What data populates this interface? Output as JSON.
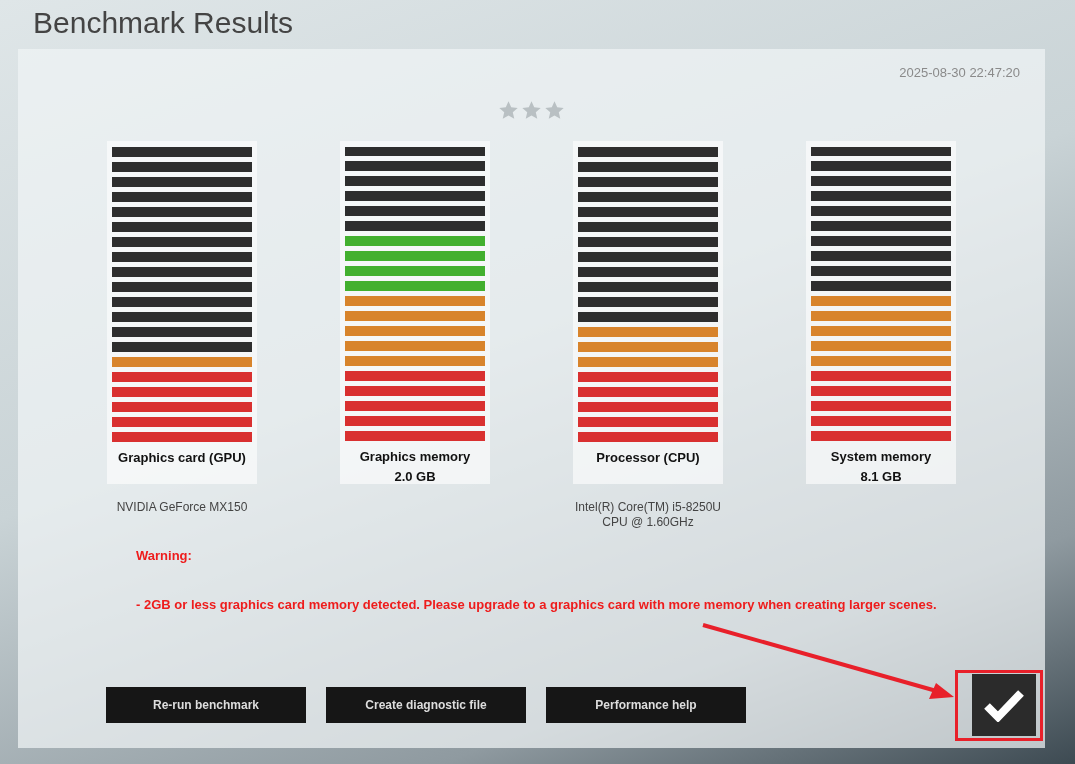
{
  "title": "Benchmark Results",
  "timestamp": "2025-08-30 22:47:20",
  "rating": {
    "stars": 0
  },
  "components": [
    {
      "label": "Graphics card (GPU)",
      "level": 0.3,
      "detail": [
        "NVIDIA GeForce MX150"
      ]
    },
    {
      "label": "Graphics memory",
      "value": "2.0 GB",
      "level": 0.7
    },
    {
      "label": "Processor (CPU)",
      "level": 0.4,
      "detail": [
        "Intel(R) Core(TM) i5-8250U",
        "CPU @ 1.60GHz"
      ]
    },
    {
      "label": "System memory",
      "value": "8.1 GB",
      "level": 0.5
    }
  ],
  "warning": {
    "heading": "Warning:",
    "message": "- 2GB or less graphics card memory detected. Please upgrade to a graphics card with more memory when creating larger scenes."
  },
  "buttons": [
    "Re-run benchmark",
    "Create diagnostic file",
    "Performance help"
  ],
  "annotation": {
    "highlight": true
  }
}
